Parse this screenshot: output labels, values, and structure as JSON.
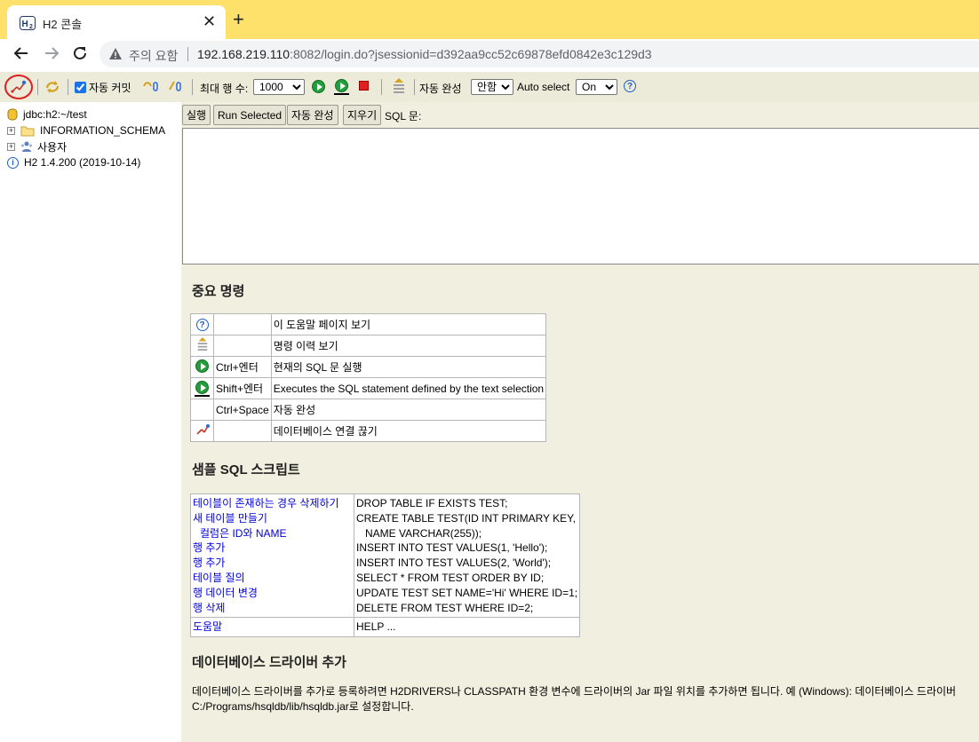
{
  "browser": {
    "tab_title": "H2 콘솔",
    "security_label": "주의 요함",
    "url_host": "192.168.219.110",
    "url_rest": ":8082/login.do?jsessionid=d392aa9cc52c69878efd0842e3c129d3"
  },
  "toolbar": {
    "auto_commit_label": "자동 커밋",
    "auto_commit_checked": true,
    "max_rows_label": "최대 행 수:",
    "max_rows_value": "1000",
    "autocomplete_label": "자동 완성",
    "autocomplete_value": "안함",
    "auto_select_label": "Auto select",
    "auto_select_value": "On"
  },
  "tree": {
    "connection": "jdbc:h2:~/test",
    "schema": "INFORMATION_SCHEMA",
    "users": "사용자",
    "version": "H2 1.4.200 (2019-10-14)"
  },
  "sql_panel": {
    "execute_button": "실행",
    "run_selected_button": "Run Selected",
    "autocomplete_button": "자동 완성",
    "clear_button": "지우기",
    "sql_label": "SQL 문:",
    "sql_text": ""
  },
  "help": {
    "important_title": "중요 명령",
    "commands": [
      {
        "icon": "help-icon",
        "shortcut": "",
        "description": "이 도움말 페이지 보기"
      },
      {
        "icon": "history-icon",
        "shortcut": "",
        "description": "명령 이력 보기"
      },
      {
        "icon": "run-icon",
        "shortcut": "Ctrl+엔터",
        "description": "현재의 SQL 문 실행"
      },
      {
        "icon": "run-selected-icon",
        "shortcut": "Shift+엔터",
        "description": "Executes the SQL statement defined by the text selection"
      },
      {
        "icon": "",
        "shortcut": "Ctrl+Space",
        "description": "자동 완성"
      },
      {
        "icon": "disconnect-icon",
        "shortcut": "",
        "description": "데이터베이스 연결 끊기"
      }
    ],
    "sample_title": "샘플 SQL 스크립트",
    "samples": [
      {
        "label": "테이블이 존재하는 경우 삭제하기",
        "sql": "DROP TABLE IF EXISTS TEST;",
        "indent": false
      },
      {
        "label": "새 테이블 만들기",
        "sql": "CREATE TABLE TEST(ID INT PRIMARY KEY,",
        "indent": false
      },
      {
        "label": "컬럼은 ID와 NAME",
        "sql": "NAME VARCHAR(255));",
        "indent": true
      },
      {
        "label": "행 추가",
        "sql": "INSERT INTO TEST VALUES(1, 'Hello');",
        "indent": false
      },
      {
        "label": "행 추가",
        "sql": "INSERT INTO TEST VALUES(2, 'World');",
        "indent": false
      },
      {
        "label": "테이블 질의",
        "sql": "SELECT * FROM TEST ORDER BY ID;",
        "indent": false
      },
      {
        "label": "행 데이터 변경",
        "sql": "UPDATE TEST SET NAME='Hi' WHERE ID=1;",
        "indent": false
      },
      {
        "label": "행 삭제",
        "sql": "DELETE FROM TEST WHERE ID=2;",
        "indent": false
      }
    ],
    "help_link": "도움말",
    "help_sql": "HELP ...",
    "driver_title": "데이터베이스 드라이버 추가",
    "driver_text": "데이터베이스 드라이버를 추가로 등록하려면 H2DRIVERS나 CLASSPATH 환경 변수에 드라이버의 Jar 파일 위치를 추가하면 됩니다. 예 (Windows): 데이터베이스 드라이버 C:/Programs/hsqldb/lib/hsqldb.jar로 설정합니다."
  },
  "colors": {
    "tabstrip": "#fde16a",
    "panel_background": "#f0efe0",
    "link": "#0000dd"
  }
}
